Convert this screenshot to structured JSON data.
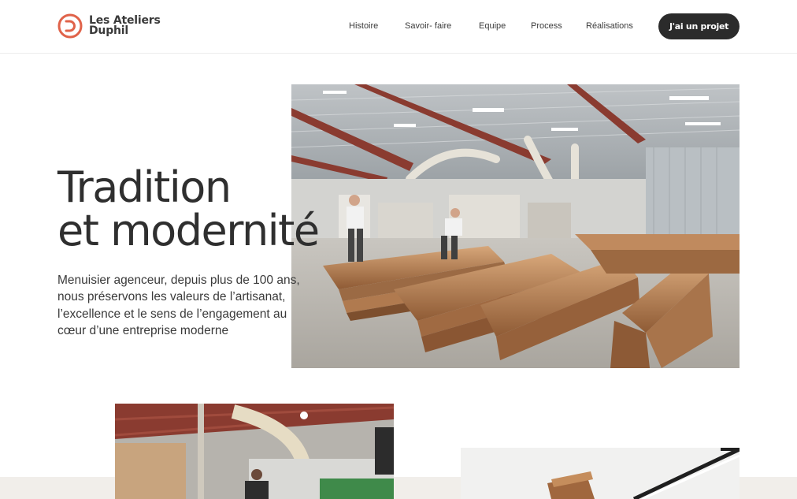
{
  "header": {
    "logo": {
      "line1": "Les Ateliers",
      "line2": "Duphil",
      "letter": "D",
      "accent": "#e0634a"
    },
    "nav": [
      {
        "label": "Histoire"
      },
      {
        "label": "Savoir- faire"
      },
      {
        "label": "Equipe"
      },
      {
        "label": "Process"
      },
      {
        "label": "Réalisations"
      }
    ],
    "cta_label": "J'ai un projet"
  },
  "hero": {
    "title_line1": "Tradition",
    "title_line2": "et modernité",
    "description": "Menuisier agenceur, depuis plus de 100 ans, nous préservons les valeurs de l’artisanat, l’excellence et le sens de l’engagement au cœur d’une entreprise moderne"
  },
  "colors": {
    "dark_button": "#2b2b2b",
    "band": "#f1eeea",
    "text": "#2f2f2f"
  }
}
